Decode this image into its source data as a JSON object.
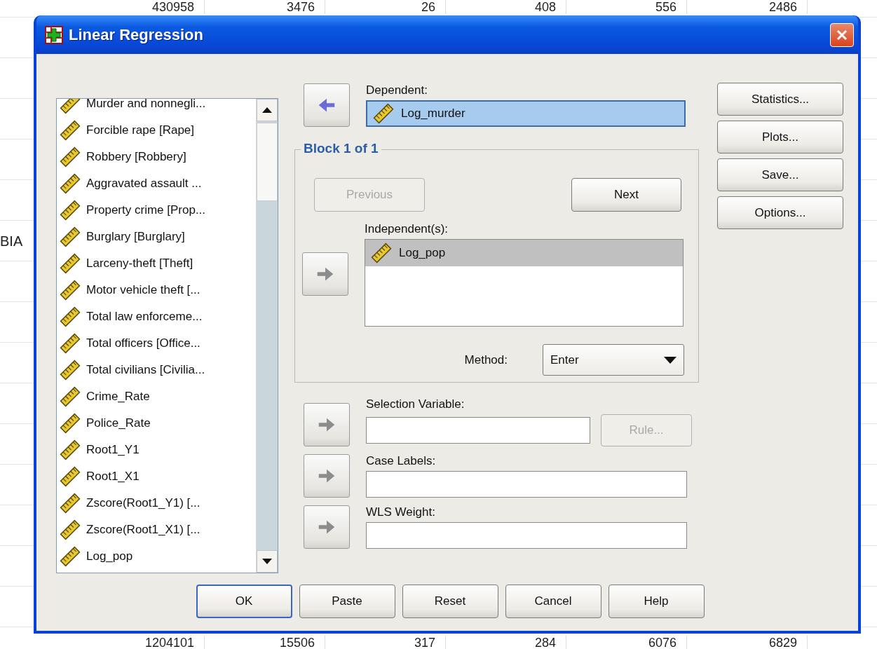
{
  "sheet": {
    "top_row": [
      "430958",
      "3476",
      "26",
      "408",
      "556",
      "2486"
    ],
    "side_label": "BIA",
    "bottom_row": [
      "1204101",
      "15506",
      "317",
      "284",
      "6076",
      "6829"
    ]
  },
  "window": {
    "title": "Linear Regression"
  },
  "variables": [
    {
      "name": "Murder and nonnegli..."
    },
    {
      "name": "Forcible rape [Rape]"
    },
    {
      "name": "Robbery [Robbery]"
    },
    {
      "name": "Aggravated assault ..."
    },
    {
      "name": "Property crime [Prop..."
    },
    {
      "name": "Burglary [Burglary]"
    },
    {
      "name": "Larceny-theft [Theft]"
    },
    {
      "name": "Motor vehicle theft [..."
    },
    {
      "name": "Total law enforceme..."
    },
    {
      "name": "Total officers [Office..."
    },
    {
      "name": "Total civilians [Civilia..."
    },
    {
      "name": "Crime_Rate"
    },
    {
      "name": "Police_Rate"
    },
    {
      "name": "Root1_Y1"
    },
    {
      "name": "Root1_X1"
    },
    {
      "name": "Zscore(Root1_Y1) [..."
    },
    {
      "name": "Zscore(Root1_X1) [..."
    },
    {
      "name": "Log_pop"
    }
  ],
  "dependent": {
    "label": "Dependent:",
    "arrow_points_left": true,
    "arrow_enabled": true,
    "items": [
      {
        "name": "Log_murder",
        "selected": true
      }
    ]
  },
  "block": {
    "title": "Block 1 of 1",
    "buttons": [
      {
        "label": "Previous",
        "disabled": true
      },
      {
        "label": "Next",
        "disabled": false
      }
    ],
    "independents": {
      "label": "Independent(s):",
      "arrow_points_left": false,
      "arrow_enabled": false,
      "items": [
        {
          "name": "Log_pop",
          "selected": true
        }
      ]
    },
    "method": {
      "label": "Method:",
      "value": "Enter"
    }
  },
  "fields": [
    {
      "label": "Selection Variable:",
      "arrow_points_left": false,
      "arrow_enabled": false,
      "button": {
        "label": "Rule...",
        "disabled": true
      }
    },
    {
      "label": "Case Labels:",
      "arrow_points_left": false,
      "arrow_enabled": false
    },
    {
      "label": "WLS Weight:",
      "arrow_points_left": false,
      "arrow_enabled": false
    }
  ],
  "side_buttons": [
    {
      "label": "Statistics..."
    },
    {
      "label": "Plots..."
    },
    {
      "label": "Save..."
    },
    {
      "label": "Options..."
    }
  ],
  "buttons": [
    {
      "label": "OK",
      "default": true
    },
    {
      "label": "Paste",
      "default": false
    },
    {
      "label": "Reset",
      "default": false
    },
    {
      "label": "Cancel",
      "default": false
    },
    {
      "label": "Help",
      "default": false
    }
  ]
}
